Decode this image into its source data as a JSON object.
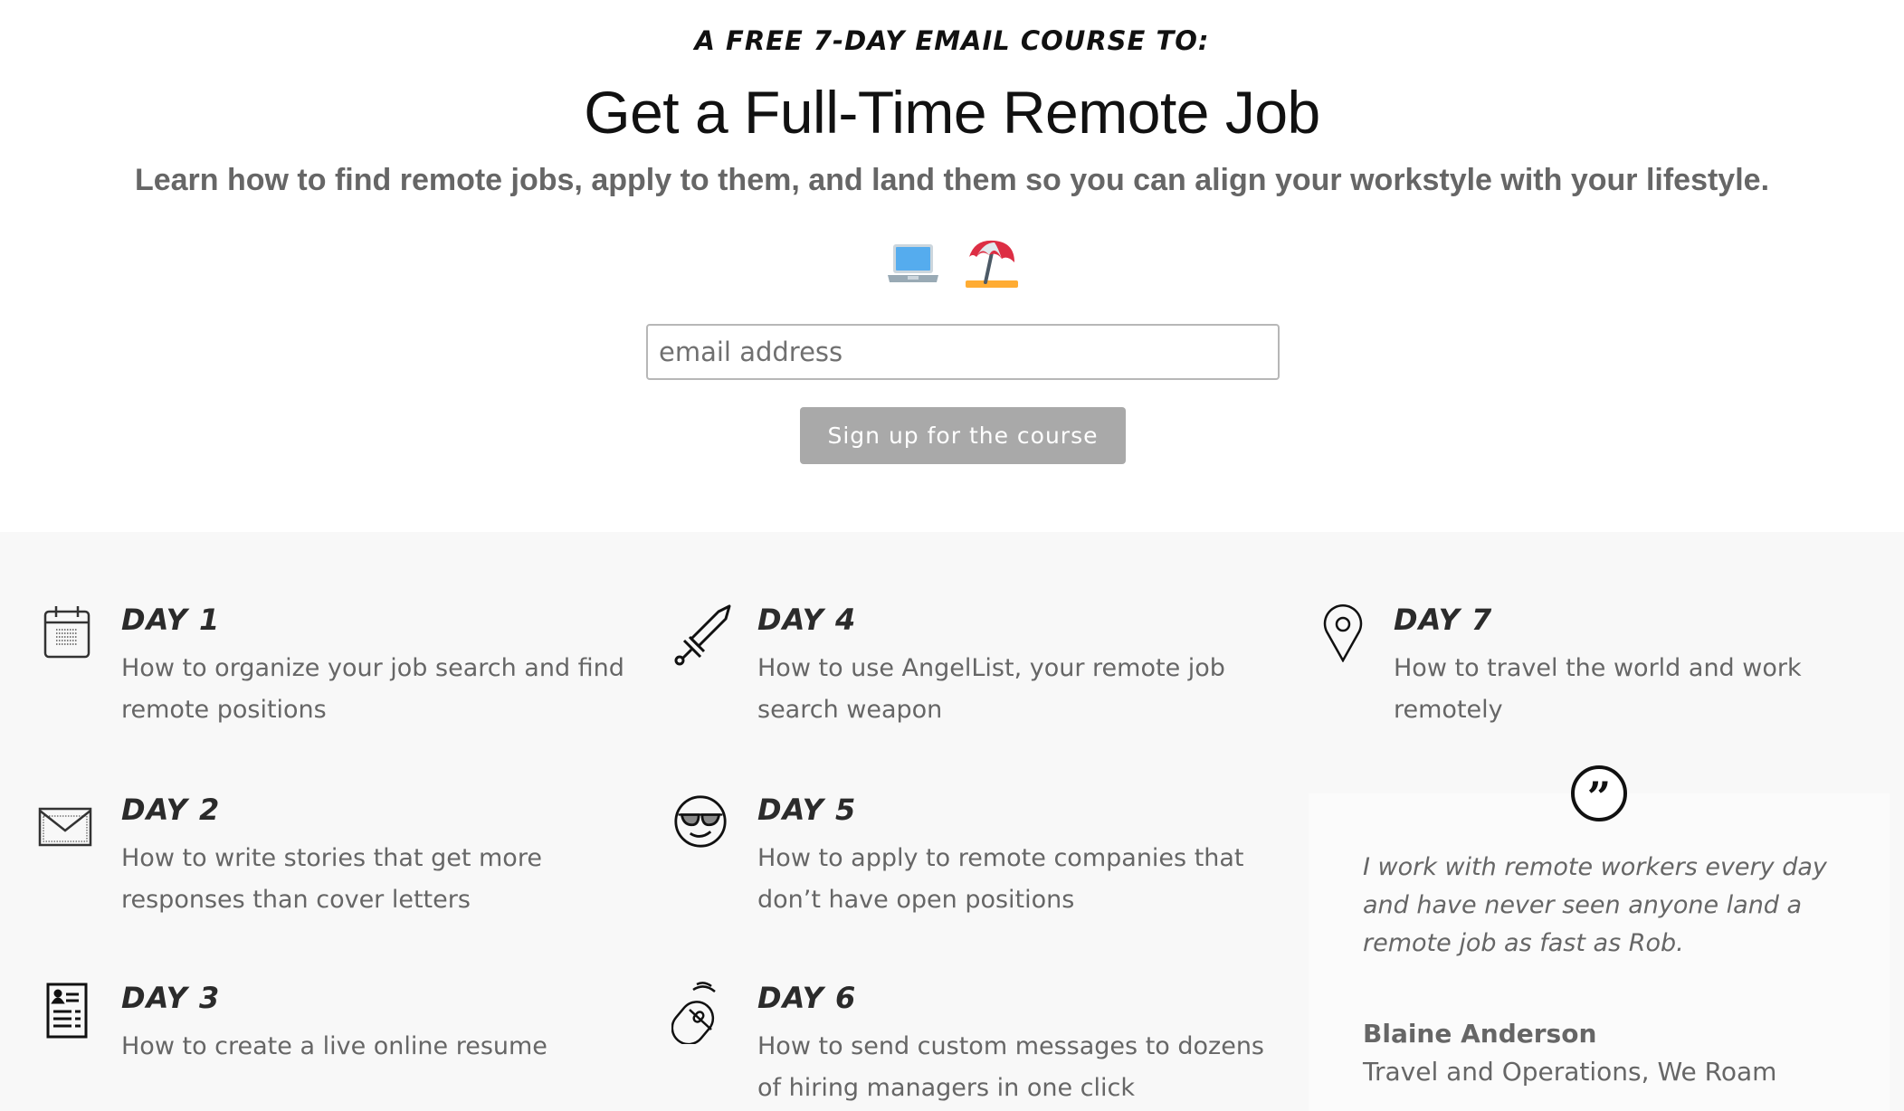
{
  "header": {
    "kicker": "A free 7-day email course to:",
    "title": "Get a Full-Time Remote Job",
    "subtitle": "Learn how to find remote jobs, apply to them, and land them so you can align your workstyle with your lifestyle.",
    "emojis": [
      "laptop-emoji",
      "beach-umbrella-emoji"
    ]
  },
  "signup": {
    "email_placeholder": "email address",
    "email_value": "",
    "button_label": "Sign up for the course"
  },
  "days": [
    {
      "title": "Day 1",
      "icon": "calendar-icon",
      "description": "How to organize your job search and find remote positions"
    },
    {
      "title": "Day 2",
      "icon": "envelope-icon",
      "description": "How to write stories that get more responses than cover letters"
    },
    {
      "title": "Day 3",
      "icon": "resume-icon",
      "description": "How to create a live online resume"
    },
    {
      "title": "Day 4",
      "icon": "sword-icon",
      "description": "How to use AngelList, your remote job search weapon"
    },
    {
      "title": "Day 5",
      "icon": "sunglasses-face-icon",
      "description": "How to apply to remote companies that don’t have open positions"
    },
    {
      "title": "Day 6",
      "icon": "mouse-click-icon",
      "description": "How to send custom messages to dozens of hiring managers in one click"
    },
    {
      "title": "Day 7",
      "icon": "map-pin-icon",
      "description": "How to travel the world and work remotely"
    }
  ],
  "testimonial": {
    "icon": "quote-icon",
    "quote": "I work with remote workers every day and have never seen anyone land a remote job as fast as Rob.",
    "author": "Blaine Anderson",
    "role": "Travel and Operations, We Roam"
  },
  "colors": {
    "section_bg": "#f8f8f8",
    "button_bg": "#a9a9a9",
    "text_grey": "#666666",
    "heading_dark": "#111111"
  }
}
